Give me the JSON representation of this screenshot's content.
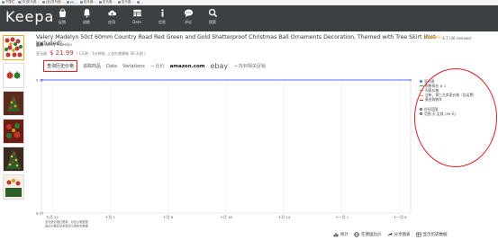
{
  "bookmarks": [
    "书签栏",
    "[中]亚马逊…",
    "[全]亚马逊…",
    "PP…",
    "亚马逊…",
    "亚马逊…",
    "亚马逊…",
    "…"
  ],
  "nav": {
    "logo": "Keepa",
    "items": [
      {
        "label": "促销",
        "icon": "shopping-bag-icon"
      },
      {
        "label": "追踪",
        "icon": "bell-icon"
      },
      {
        "label": "应用",
        "icon": "cloud-icon"
      },
      {
        "label": "Data",
        "icon": "table-icon"
      },
      {
        "label": "信息",
        "icon": "info-icon"
      },
      {
        "label": "评论",
        "icon": "chat-icon"
      },
      {
        "label": "搜索",
        "icon": "search-icon"
      }
    ]
  },
  "product": {
    "title": "Valery Madelyn 50ct 60mm Country Road Red Green and Gold Shatterproof Christmas Ball Ornaments Decoration, Themed with Tree Skirt (Not Included)",
    "rating_stars": "★★★★½",
    "rating_text": "4.7 (36 reviews)",
    "brand_label": "品牌",
    "brand": "Valery Madelyn",
    "price_label": "亚马逊",
    "price": "$ 21.99",
    "price_note": "( 1天前 - 1分钟前, 上次价格更新 30 天前 )"
  },
  "tabs": [
    {
      "label": "查询历史价格",
      "kind": "active"
    },
    {
      "label": "追踪商品",
      "kind": "normal"
    },
    {
      "label": "Data",
      "kind": "normal"
    },
    {
      "label": "Variations",
      "kind": "normal"
    },
    {
      "label": "→ 比价",
      "kind": "arrow"
    },
    {
      "label": "amazon.com",
      "kind": "amazon"
    },
    {
      "label": "ebay",
      "kind": "ebay"
    },
    {
      "label": "→ 找到相关促销",
      "kind": "arrow"
    }
  ],
  "chart_data": {
    "type": "line",
    "x_ticks": [
      "九月 22",
      "十月 1",
      "十月 8",
      "十月 16",
      "十月 24",
      "十一月 1",
      "十一月 8"
    ],
    "y_ticks": [
      "$ 22",
      "$ 21"
    ],
    "ylim": [
      21,
      22
    ],
    "series": [
      {
        "name": "亚马逊",
        "color": "#4c6fff",
        "x": [
          "九月 22",
          "十一月 8"
        ],
        "values": [
          22,
          22
        ]
      }
    ],
    "grid": true,
    "legend_position": "right"
  },
  "chart_footnote": [
    "亚马逊价格已更新。对比价格按照",
    "最近价格变动来自亚马逊实时数据"
  ],
  "legend": {
    "rows": [
      {
        "label": "亚马逊",
        "swatch": "#4c6fff",
        "kind": "dot"
      },
      {
        "label": "销售排名 # 1",
        "swatch": "#3aa757",
        "kind": "line"
      },
      {
        "label": "列表价格",
        "swatch": "#999999",
        "kind": "line"
      },
      {
        "label": "全新，第三方卖家价格（含运费）",
        "swatch": "#e6a23c",
        "kind": "line"
      },
      {
        "label": "黄金购物车",
        "swatch": "#e21f26",
        "kind": "line"
      },
      {
        "label": "",
        "swatch": "#ffffff",
        "kind": "blank"
      },
      {
        "label": "时间范围",
        "swatch": "#555555",
        "kind": "icon"
      },
      {
        "label": "范围 天 全部 (36 天)",
        "swatch": "#555555",
        "kind": "icon"
      }
    ]
  },
  "bottombar": {
    "stats": "统计",
    "compare": "在德国比价",
    "share": "分享图表",
    "history": "显示历史数据"
  }
}
